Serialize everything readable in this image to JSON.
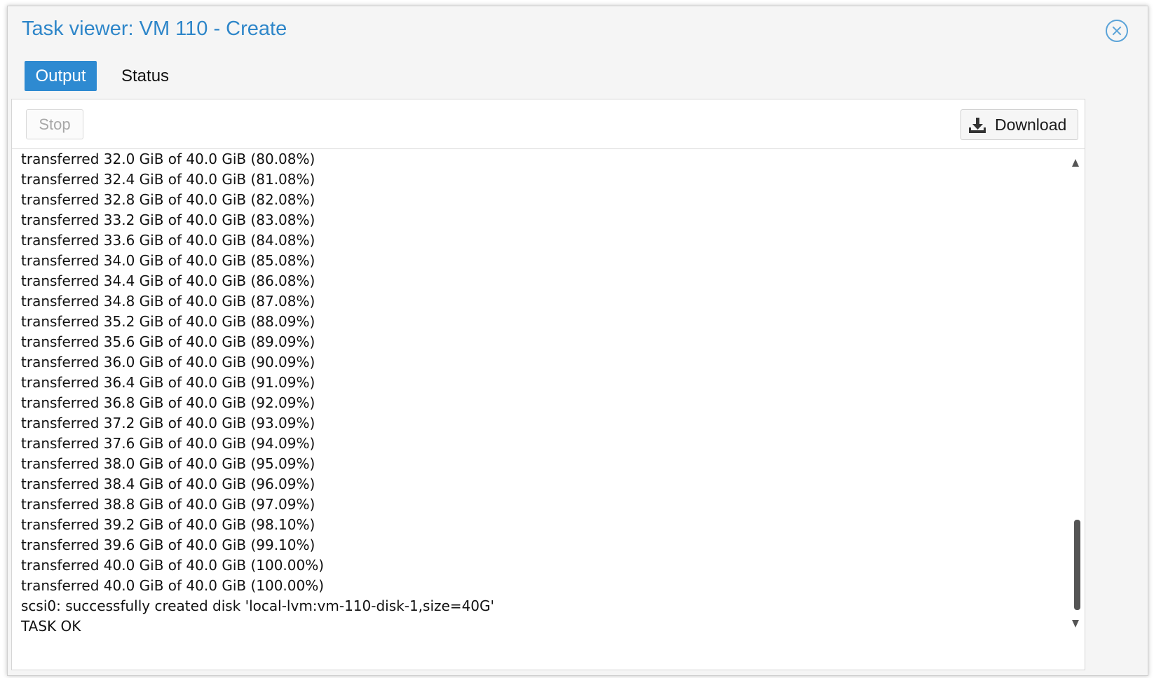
{
  "dialog": {
    "title": "Task viewer: VM 110 - Create",
    "close_icon": "close-circle-icon"
  },
  "tabs": [
    {
      "label": "Output",
      "active": true
    },
    {
      "label": "Status",
      "active": false
    }
  ],
  "toolbar": {
    "stop_label": "Stop",
    "stop_enabled": false,
    "download_label": "Download",
    "download_icon": "download-icon"
  },
  "log": {
    "lines": [
      "transferred 32.0 GiB of 40.0 GiB (80.08%)",
      "transferred 32.4 GiB of 40.0 GiB (81.08%)",
      "transferred 32.8 GiB of 40.0 GiB (82.08%)",
      "transferred 33.2 GiB of 40.0 GiB (83.08%)",
      "transferred 33.6 GiB of 40.0 GiB (84.08%)",
      "transferred 34.0 GiB of 40.0 GiB (85.08%)",
      "transferred 34.4 GiB of 40.0 GiB (86.08%)",
      "transferred 34.8 GiB of 40.0 GiB (87.08%)",
      "transferred 35.2 GiB of 40.0 GiB (88.09%)",
      "transferred 35.6 GiB of 40.0 GiB (89.09%)",
      "transferred 36.0 GiB of 40.0 GiB (90.09%)",
      "transferred 36.4 GiB of 40.0 GiB (91.09%)",
      "transferred 36.8 GiB of 40.0 GiB (92.09%)",
      "transferred 37.2 GiB of 40.0 GiB (93.09%)",
      "transferred 37.6 GiB of 40.0 GiB (94.09%)",
      "transferred 38.0 GiB of 40.0 GiB (95.09%)",
      "transferred 38.4 GiB of 40.0 GiB (96.09%)",
      "transferred 38.8 GiB of 40.0 GiB (97.09%)",
      "transferred 39.2 GiB of 40.0 GiB (98.10%)",
      "transferred 39.6 GiB of 40.0 GiB (99.10%)",
      "transferred 40.0 GiB of 40.0 GiB (100.00%)",
      "transferred 40.0 GiB of 40.0 GiB (100.00%)",
      "scsi0: successfully created disk 'local-lvm:vm-110-disk-1,size=40G'",
      "TASK OK"
    ]
  }
}
